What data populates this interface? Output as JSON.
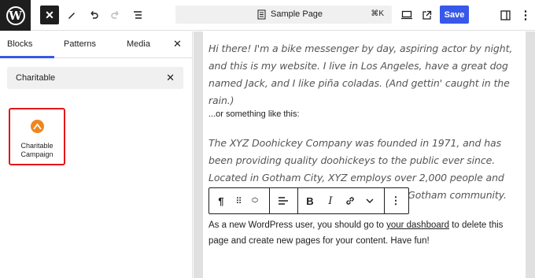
{
  "toolbar": {
    "document_title": "Sample Page",
    "shortcut": "⌘K",
    "save_label": "Save",
    "icons": [
      "wordpress-logo",
      "close-icon",
      "pen-icon",
      "undo-icon",
      "redo-icon",
      "list-view-icon",
      "document-icon",
      "desktop-icon",
      "external-link-icon",
      "sidebar-icon",
      "more-options-icon"
    ]
  },
  "inserter": {
    "tabs": [
      "Blocks",
      "Patterns",
      "Media"
    ],
    "active_tab": "Blocks",
    "search_value": "Charitable",
    "results": [
      {
        "label": "Charitable Campaign",
        "icon": "charitable-icon",
        "color": "#f0851e",
        "highlight_color": "#e3171b"
      }
    ]
  },
  "content": {
    "paragraph1": "Hi there! I'm a bike messenger by day, aspiring actor by night, and this is my website. I live in Los Angeles, have a great dog named Jack, and I like piña coladas. (And gettin' caught in the rain.)",
    "paragraph2": "...or something like this:",
    "paragraph3": "The XYZ Doohickey Company was founded in 1971, and has been providing quality doohickeys to the public ever since. Located in Gotham City, XYZ employs over 2,000 people and does all kinds of awesome things for the Gotham community.",
    "paragraph4_before": "As a new WordPress user, you should go to ",
    "paragraph4_link": "your dashboard",
    "paragraph4_after": " to delete this page and create new pages for your content. Have fun!"
  },
  "block_toolbar": {
    "icons": [
      "paragraph-icon",
      "drag-handle-icon",
      "move-up-down-icon",
      "align-icon",
      "bold-icon",
      "italic-icon",
      "link-icon",
      "more-rich-text-icon",
      "options-icon"
    ]
  },
  "colors": {
    "accent": "#3858e9",
    "dark": "#1e1e1e"
  }
}
